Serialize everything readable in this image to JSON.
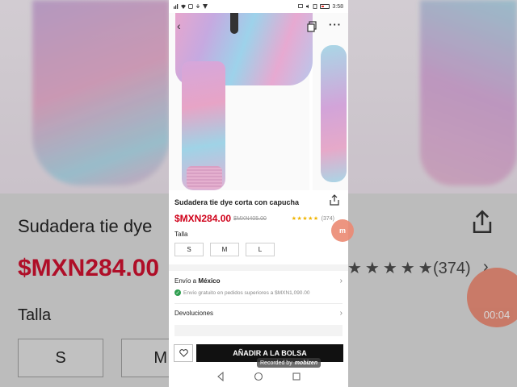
{
  "status_bar": {
    "time": "3:58"
  },
  "product": {
    "title": "Sudadera tie dye corta con capucha",
    "price": "$MXN284.00",
    "original_price": "$MXN405.00",
    "rating_stars": "★★★★★",
    "review_count": "(374)",
    "size_label": "Talla",
    "sizes": [
      "S",
      "M",
      "L"
    ]
  },
  "shipping": {
    "label": "Envío a",
    "country": "México",
    "free_note": "Envío gratuito en pedidos superiores a $MXN1,090.00"
  },
  "returns": {
    "label": "Devoluciones"
  },
  "actions": {
    "add_to_bag": "AÑADIR A LA BOLSA"
  },
  "background": {
    "title_fragment": "Sudadera tie dye",
    "price_fragment": "$MXN284.00",
    "size_label": "Talla",
    "size_s": "S",
    "size_m": "M",
    "stars": "★★★★★",
    "review_count": "(374)"
  },
  "recorder": {
    "watermark_prefix": "Recorded by",
    "watermark_brand": "mobizen",
    "timer": "00:04",
    "badge": "m"
  },
  "colors": {
    "accent_price": "#d0021b",
    "stars": "#f0b400",
    "add_button": "#111111",
    "check": "#2e9e4f"
  },
  "icons": [
    "back-arrow-icon",
    "copy-icon",
    "more-icon",
    "share-icon",
    "heart-icon",
    "check-icon",
    "chevron-right-icon",
    "nav-back-icon",
    "nav-home-icon",
    "nav-recents-icon"
  ]
}
